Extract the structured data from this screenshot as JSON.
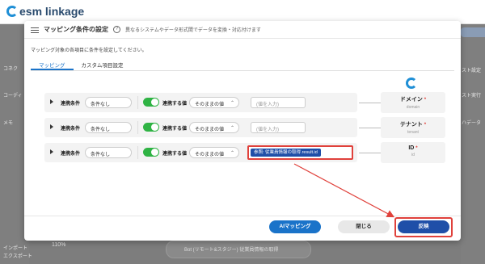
{
  "app": {
    "logo_text": "esm linkage",
    "left_items": [
      "コネク",
      "コーディ",
      "メモ",
      "インポート",
      "エクスポート"
    ],
    "right_items": [
      "スト設定",
      "スト実行",
      "ハデータ"
    ],
    "zoom": "110%",
    "bottom_bar_text": "Bot (リモート&スタジー) 従業員情報の取得",
    "colors": {
      "accent": "#1a73c9",
      "primary_dark": "#1f4fa8",
      "toggle_on": "#2fb344",
      "annotation_red": "#e0413b"
    }
  },
  "modal": {
    "title": "マッピング条件の設定",
    "subtitle": "異なるシステムやデータ形式間でデータを変換・対応付けます",
    "description": "マッピング対象の各項目に条件を設定してください。",
    "help_icon": "help-icon",
    "tabs": [
      {
        "label": "マッピング",
        "active": true
      },
      {
        "label": "カスタム項目設定",
        "active": false
      }
    ],
    "rows": [
      {
        "condition_label": "連携条件",
        "condition_value": "条件なし",
        "toggle_on": true,
        "link_label": "連携する値",
        "value_mode": "そのままの値",
        "value_placeholder": "(値を入力)",
        "value_chip": null,
        "target_name": "ドメイン",
        "target_required": "*",
        "target_key": "domain"
      },
      {
        "condition_label": "連携条件",
        "condition_value": "条件なし",
        "toggle_on": true,
        "link_label": "連携する値",
        "value_mode": "そのままの値",
        "value_placeholder": "(値を入力)",
        "value_chip": null,
        "target_name": "テナント",
        "target_required": "*",
        "target_key": "tenant"
      },
      {
        "condition_label": "連携条件",
        "condition_value": "条件なし",
        "toggle_on": true,
        "link_label": "連携する値",
        "value_mode": "そのままの値",
        "value_placeholder": "",
        "value_chip": "参照: 従業員情報の取得.result.id",
        "target_name": "ID",
        "target_required": "*",
        "target_key": "id"
      }
    ],
    "buttons": {
      "ai_mapping": "AIマッピング",
      "close": "閉じる",
      "apply": "反映"
    }
  }
}
